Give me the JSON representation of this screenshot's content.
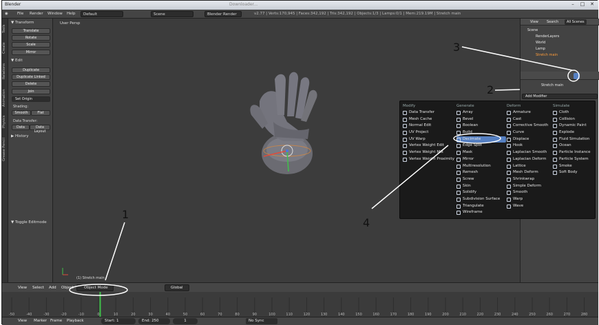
{
  "titlebar": {
    "app": "Blender",
    "title": "Downloader...",
    "close": "✕",
    "min": "–",
    "max": "□"
  },
  "info_menu": [
    "File",
    "Render",
    "Window",
    "Help"
  ],
  "screen_layout": "Default",
  "scene_name": "Scene",
  "render_engine": "Blender Render",
  "stats": "v2.77 | Verts:170,945 | Faces:342,192 | Tris:342,192 | Objects:1/3 | Lamps:0/1 | Mem:219.19M | Stretch main",
  "tool_tabs": [
    "Tools",
    "Create",
    "Relations",
    "Animation",
    "Physics",
    "Grease Pencil"
  ],
  "toolshelf": {
    "transform_header": "▼ Transform",
    "transform": [
      "Translate",
      "Rotate",
      "Scale",
      "Mirror"
    ],
    "edit_header": "▼ Edit",
    "edit": [
      "Duplicate",
      "Duplicate Linked",
      "Delete",
      "Join"
    ],
    "set_origin": "Set Origin",
    "shading_label": "Shading:",
    "smooth": "Smooth",
    "flat": "Flat",
    "data_transfer_label": "Data Transfer:",
    "data": "Data",
    "data_layout": "Data Layout",
    "history_header": "▶ History",
    "toggle_editmode": "▼ Toggle Editmode"
  },
  "viewport_label": "User Persp",
  "object_label": "(1) Stretch main",
  "view3d_header": {
    "menus": [
      "View",
      "Select",
      "Add",
      "Object"
    ],
    "mode": "Object Mode",
    "orientation": "Global"
  },
  "timeline_header": {
    "menus": [
      "View",
      "Marker",
      "Frame",
      "Playback"
    ],
    "start_label": "Start:",
    "start": "1",
    "end_label": "End:",
    "end": "250",
    "current": "1",
    "sync": "No Sync"
  },
  "timeline_ticks": [
    "-50",
    "-40",
    "-30",
    "-20",
    "-10",
    "0",
    "10",
    "20",
    "30",
    "40",
    "50",
    "60",
    "70",
    "80",
    "90",
    "100",
    "110",
    "120",
    "130",
    "140",
    "150",
    "160",
    "170",
    "180",
    "190",
    "200",
    "210",
    "220",
    "230",
    "240",
    "250",
    "260",
    "270",
    "280"
  ],
  "outliner": {
    "menus": [
      "View",
      "Search",
      "All Scenes"
    ],
    "items": [
      "Scene",
      "RenderLayers",
      "World",
      "Lamp",
      "Stretch main"
    ]
  },
  "properties": {
    "object_name": "Stretch main",
    "add_modifier": "Add Modifier"
  },
  "modifier_menu": {
    "columns": [
      {
        "header": "Modify",
        "items": [
          "Data Transfer",
          "Mesh Cache",
          "Normal Edit",
          "UV Project",
          "UV Warp",
          "Vertex Weight Edit",
          "Vertex Weight Mix",
          "Vertex Weight Proximity"
        ]
      },
      {
        "header": "Generate",
        "items": [
          "Array",
          "Bevel",
          "Boolean",
          "Build",
          "Decimate",
          "Edge Split",
          "Mask",
          "Mirror",
          "Multiresolution",
          "Remesh",
          "Screw",
          "Skin",
          "Solidify",
          "Subdivision Surface",
          "Triangulate",
          "Wireframe"
        ]
      },
      {
        "header": "Deform",
        "items": [
          "Armature",
          "Cast",
          "Corrective Smooth",
          "Curve",
          "Displace",
          "Hook",
          "Laplacian Smooth",
          "Laplacian Deform",
          "Lattice",
          "Mesh Deform",
          "Shrinkwrap",
          "Simple Deform",
          "Smooth",
          "Warp",
          "Wave"
        ]
      },
      {
        "header": "Simulate",
        "items": [
          "Cloth",
          "Collision",
          "Dynamic Paint",
          "Explode",
          "Fluid Simulation",
          "Ocean",
          "Particle Instance",
          "Particle System",
          "Smoke",
          "Soft Body"
        ]
      }
    ]
  },
  "callouts": [
    "1",
    "2",
    "3",
    "4"
  ]
}
